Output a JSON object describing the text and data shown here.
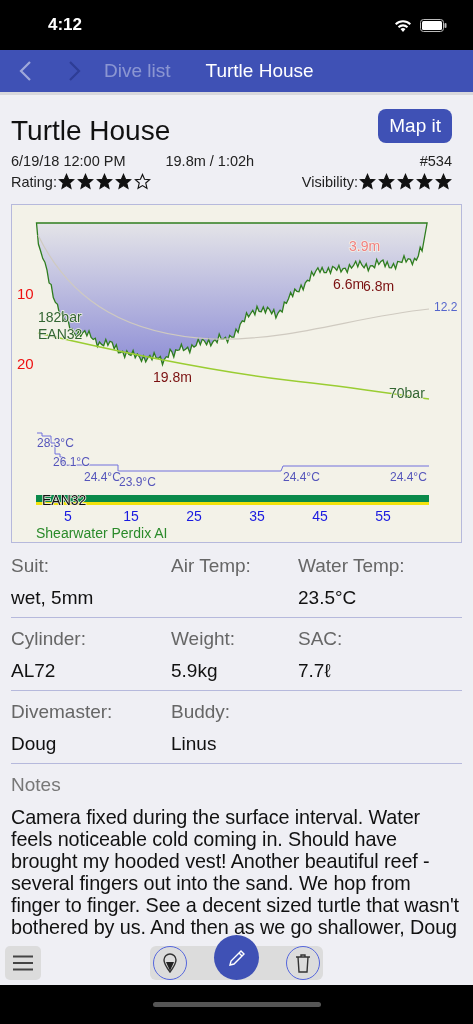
{
  "status_bar": {
    "time": "4:12"
  },
  "nav": {
    "crumbs": [
      {
        "label": "Dive list",
        "selected": false
      },
      {
        "label": "Turtle House",
        "selected": true
      }
    ]
  },
  "header": {
    "title": "Turtle House",
    "map_button": "Map it",
    "datetime": "6/19/18 12:00 PM",
    "depth_time": "19.8m / 1:02h",
    "number": "#534",
    "rating": {
      "label": "Rating:",
      "stars": 4
    },
    "visibility": {
      "label": "Visibility:",
      "stars": 5
    }
  },
  "profile": {
    "y_labels": [
      "10",
      "20"
    ],
    "x_labels": [
      "5",
      "15",
      "25",
      "35",
      "45",
      "55"
    ],
    "annotations": [
      {
        "kind": "min-depth",
        "text": "3.9m"
      },
      {
        "kind": "depth",
        "text": "6.6m"
      },
      {
        "kind": "depth",
        "text": "6.8m"
      },
      {
        "kind": "ceiling",
        "text": "12.2"
      },
      {
        "kind": "pressure",
        "text": "182bar"
      },
      {
        "kind": "gas",
        "text": "EAN32"
      },
      {
        "kind": "depth",
        "text": "19.8m"
      },
      {
        "kind": "pressure",
        "text": "70bar"
      },
      {
        "kind": "temp",
        "text": "28.3°C"
      },
      {
        "kind": "temp",
        "text": "26.1°C"
      },
      {
        "kind": "temp",
        "text": "24.4°C"
      },
      {
        "kind": "temp",
        "text": "23.9°C"
      },
      {
        "kind": "temp",
        "text": "24.4°C"
      },
      {
        "kind": "temp",
        "text": "24.4°C"
      },
      {
        "kind": "gas-bar",
        "text": "EAN32"
      }
    ],
    "device": "Shearwater Perdix AI"
  },
  "fields": [
    [
      {
        "label": "Suit:",
        "value": "wet, 5mm"
      },
      {
        "label": "Air Temp:"
      },
      {
        "label": "Water Temp:",
        "value": "23.5°C"
      }
    ],
    [
      {
        "label": "Cylinder:",
        "value": "AL72"
      },
      {
        "label": "Weight:",
        "value": "5.9kg"
      },
      {
        "label": "SAC:",
        "value": "7.7ℓ"
      }
    ],
    [
      {
        "label": "Divemaster:",
        "value": "Doug"
      },
      {
        "label": "Buddy:",
        "value": "Linus"
      }
    ]
  ],
  "notes": {
    "label": "Notes",
    "text": "Camera fixed during the surface interval. Water feels noticeable cold coming in. Should have brought my hooded vest! Another beautiful reef - several fingers out into the sand. We hop from finger to finger. See a decent sized turtle that wasn't bothered by us. And then as we go shallower, Doug"
  }
}
